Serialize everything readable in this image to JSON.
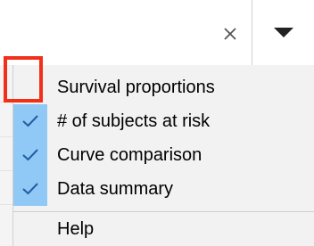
{
  "combo": {
    "clear_icon": "close-icon",
    "dropdown_icon": "caret-down-icon"
  },
  "menu": {
    "items": [
      {
        "label": "Survival proportions",
        "checked": false
      },
      {
        "label": "# of subjects at risk",
        "checked": true
      },
      {
        "label": "Curve comparison",
        "checked": true
      },
      {
        "label": "Data summary",
        "checked": true
      }
    ],
    "help_label": "Help"
  },
  "colors": {
    "check_background": "#90c8f6",
    "checkmark": "#1f5f9e",
    "highlight_border": "#f2301a",
    "menu_background": "#f2f2f2"
  }
}
